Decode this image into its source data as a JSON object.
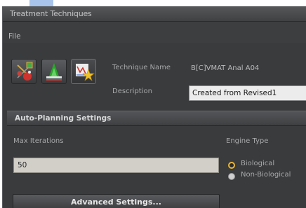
{
  "window": {
    "title": "Treatment Techniques"
  },
  "menu": {
    "file": "File"
  },
  "toolbar": {
    "buttons": [
      {
        "icon": "beams-icon"
      },
      {
        "icon": "dose-profile-icon"
      },
      {
        "icon": "star-chart-icon",
        "selected": true
      }
    ]
  },
  "technique": {
    "name_label": "Technique Name",
    "name_value": "B[C]VMAT Anal A04",
    "description_label": "Description",
    "description_value": "Created from Revised1"
  },
  "auto_planning": {
    "section_title": "Auto-Planning Settings",
    "max_iterations_label": "Max Iterations",
    "max_iterations_value": "50",
    "engine_type_label": "Engine Type",
    "engine_options": [
      {
        "label": "Biological",
        "selected": true
      },
      {
        "label": "Non-Biological",
        "selected": false
      }
    ],
    "advanced_button": "Advanced Settings..."
  },
  "colors": {
    "background": "#3a3b3d",
    "radio_selected": "#e8b53a",
    "field_background": "#ececec"
  }
}
